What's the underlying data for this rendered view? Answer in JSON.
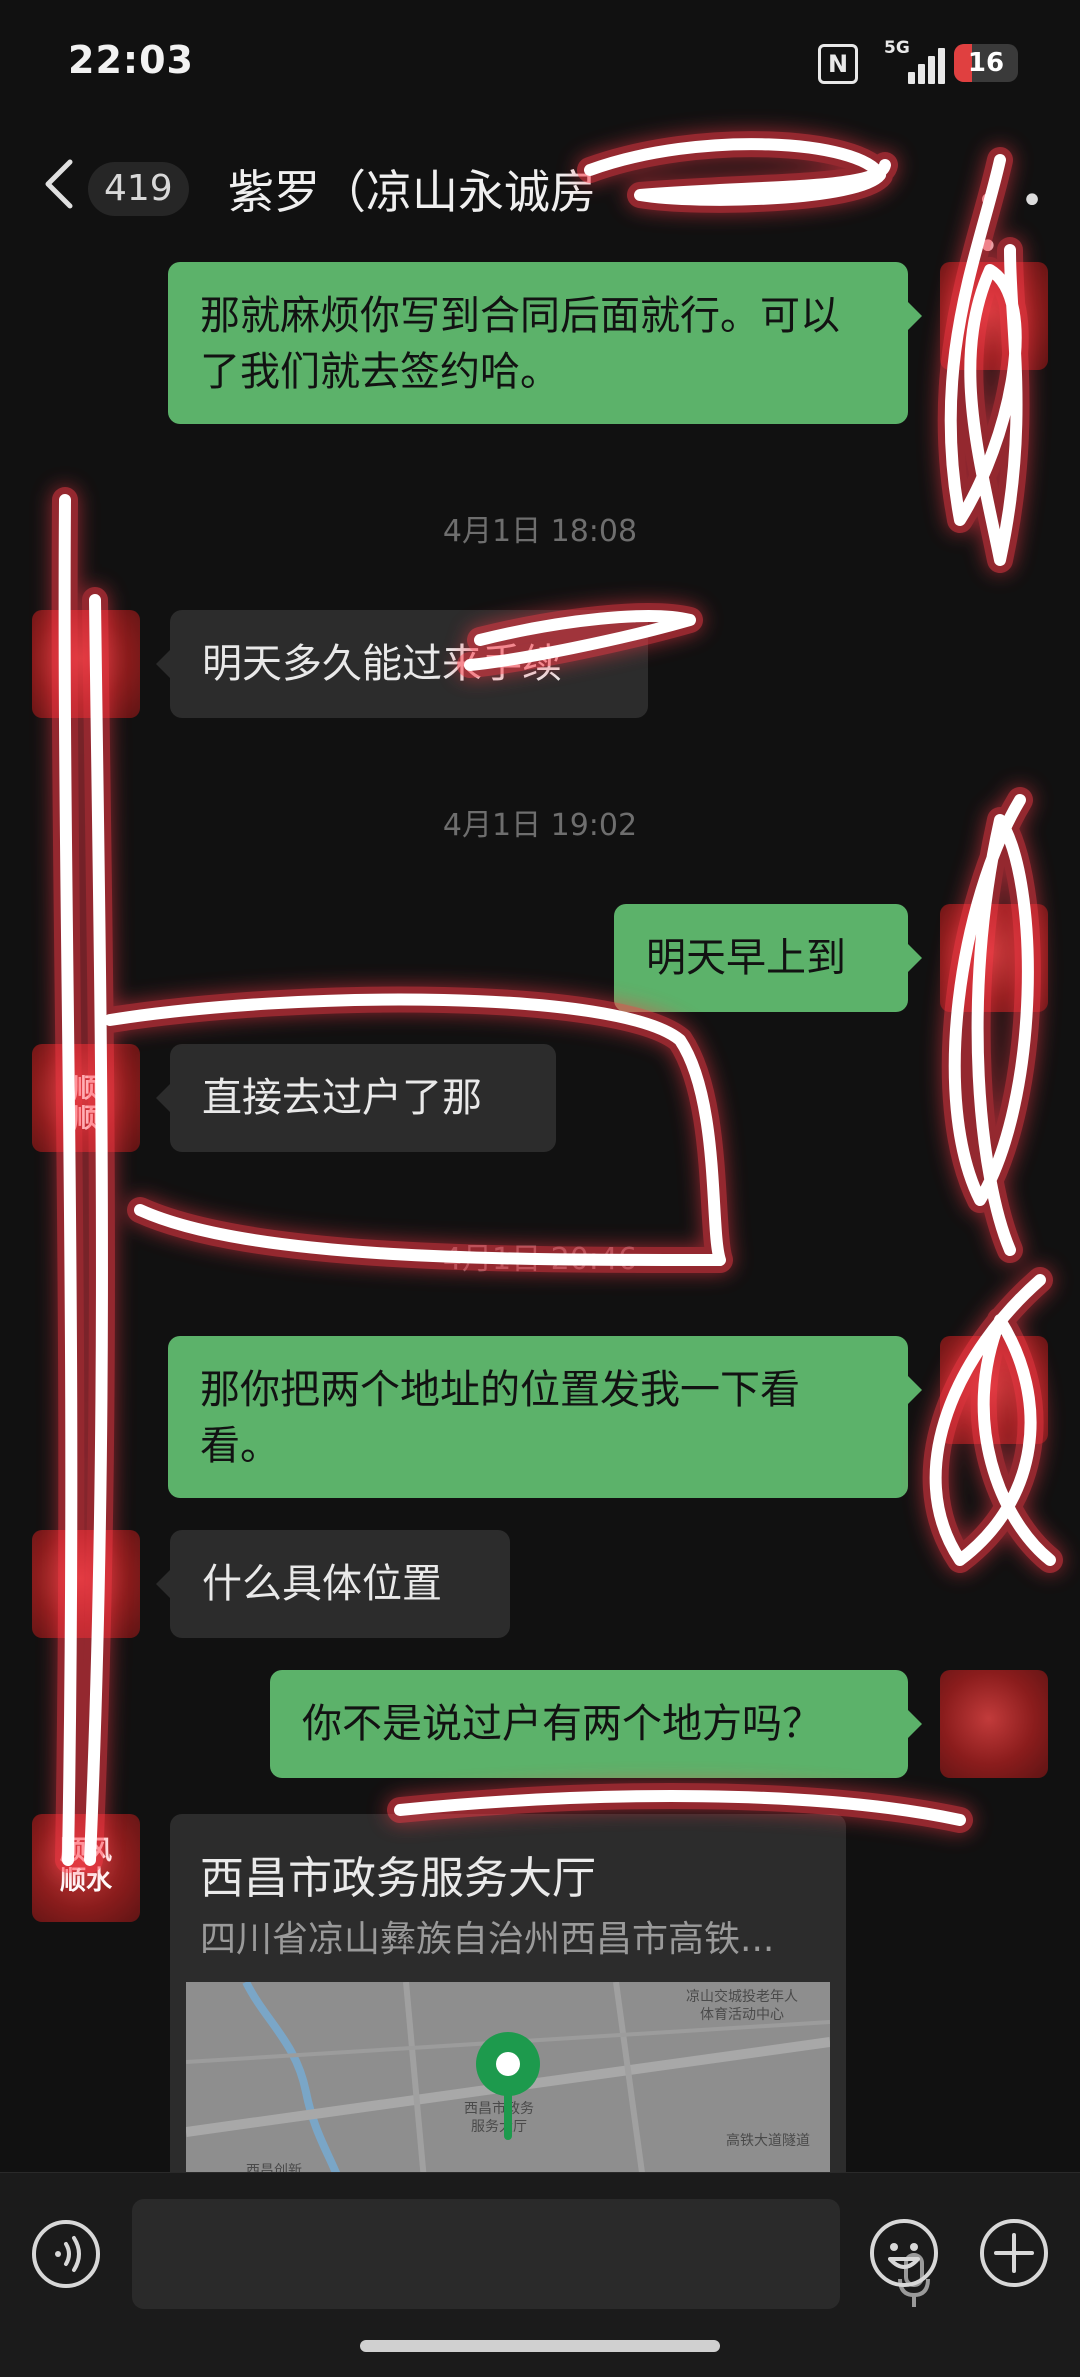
{
  "status_bar": {
    "time": "22:03",
    "network": "5G",
    "battery": "16",
    "nfc_label": "N"
  },
  "header": {
    "unread_count": "419",
    "title": "紫罗（凉山永诚房"
  },
  "messages": {
    "m1": {
      "text": "那就麻烦你写到合同后面就行。可以了我们就去签约哈。"
    },
    "t1": {
      "text": "4月1日 18:08"
    },
    "m2": {
      "text": "明天多久能过来手续"
    },
    "t2": {
      "text": "4月1日 19:02"
    },
    "m3": {
      "text": "明天早上到"
    },
    "m4": {
      "text": "直接去过户了那"
    },
    "t3": {
      "text": "4月1日 20:46"
    },
    "m5": {
      "text": "那你把两个地址的位置发我一下看看。"
    },
    "m6": {
      "text": "什么具体位置"
    },
    "m7": {
      "text": "你不是说过户有两个地方吗？"
    }
  },
  "avatars": {
    "left_a": "",
    "left_b": "顺\n顺",
    "left_c": "",
    "left_d": "顺风\n顺水"
  },
  "location_card": {
    "name": "西昌市政务服务大厅",
    "address": "四川省凉山彝族自治州西昌市高铁...",
    "map_labels": {
      "top_right": "凉山交城投老年人\n体育活动中心",
      "center": "西昌市政务\n服务大厅",
      "bottom_left": "西昌创新\n创业中心",
      "bottom_right": "高铁大道隧道"
    }
  },
  "colors": {
    "background": "#111111",
    "incoming_bubble": "#2c2c2c",
    "outgoing_bubble": "#5cb26a",
    "scribble": "#ffffff",
    "scribble_glow": "#ff3b4a"
  },
  "icons": [
    "back-chevron-icon",
    "more-icon",
    "voice-icon",
    "mic-icon",
    "emoji-icon",
    "plus-icon",
    "location-pin-icon",
    "nfc-icon",
    "signal-icon",
    "battery-icon"
  ]
}
